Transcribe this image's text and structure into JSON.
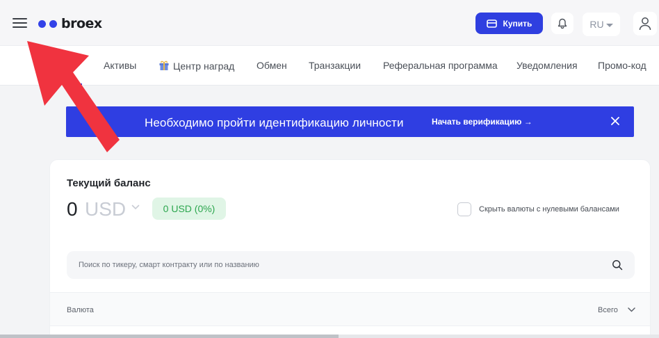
{
  "header": {
    "logo_text": "broex",
    "buy_label": "Купить",
    "language": "RU"
  },
  "tabs": [
    {
      "label": "ок",
      "active": true
    },
    {
      "label": "Активы"
    },
    {
      "label": "Центр наград",
      "icon": "gift-icon"
    },
    {
      "label": "Обмен"
    },
    {
      "label": "Транзакции"
    },
    {
      "label": "Реферальная программа"
    },
    {
      "label": "Уведомления"
    },
    {
      "label": "Промо-код"
    }
  ],
  "banner": {
    "message": "Необходимо пройти идентификацию личности",
    "cta": "Начать верификацию →"
  },
  "balance": {
    "title": "Текущий баланс",
    "amount": "0",
    "currency": "USD",
    "change": "0 USD (0%)",
    "hide_zero_label": "Скрыть валюты с нулевыми балансами",
    "hide_zero_checked": false
  },
  "search": {
    "placeholder": "Поиск по тикеру, смарт контракту или по названию"
  },
  "table": {
    "col_currency": "Валюта",
    "col_total": "Всего"
  },
  "colors": {
    "accent": "#2f3fe0",
    "positive": "#2ca64e",
    "positive_bg": "#e0f5e6",
    "arrow": "#f0333f"
  }
}
